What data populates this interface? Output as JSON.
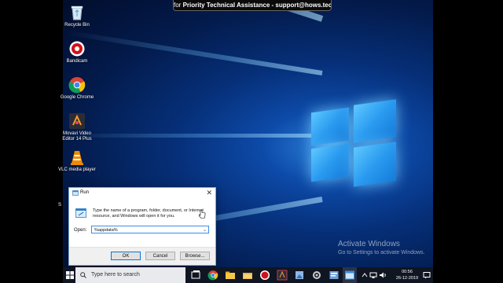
{
  "banner": {
    "prefix": "for ",
    "bold": "Priority Technical Assistance - support@hows.tech"
  },
  "desktop_icons": [
    {
      "label": "Recycle Bin",
      "icon": "recycle-bin-icon"
    },
    {
      "label": "Bandicam",
      "icon": "bandicam-icon"
    },
    {
      "label": "Google Chrome",
      "icon": "chrome-icon"
    },
    {
      "label": "Movavi Video Editor 14 Plus",
      "icon": "movavi-icon"
    },
    {
      "label": "VLC media player",
      "icon": "vlc-icon"
    }
  ],
  "partial_icon_label": "S",
  "run_dialog": {
    "title": "Run",
    "description": "Type the name of a program, folder, document, or Internet resource, and Windows will open it for you.",
    "open_label": "Open:",
    "input_value": "%appdata%",
    "ok": "OK",
    "cancel": "Cancel",
    "browse": "Browse..."
  },
  "watermark": {
    "line1": "Activate Windows",
    "line2": "Go to Settings to activate Windows."
  },
  "taskbar": {
    "search_placeholder": "Type here to search",
    "time": "00:56",
    "date": "26-12-2019"
  },
  "colors": {
    "taskbar": "#101522",
    "accent": "#0078d7",
    "desktop_dark": "#031a4a"
  }
}
